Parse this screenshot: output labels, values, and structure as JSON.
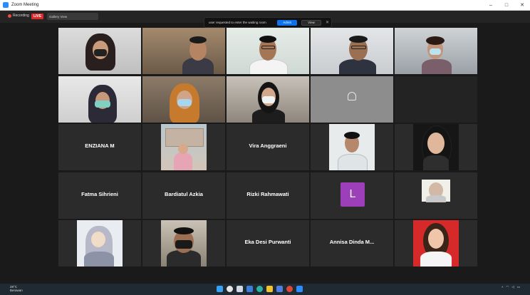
{
  "window": {
    "title": "Zoom Meeting",
    "controls": {
      "minimize": "–",
      "maximize": "□",
      "close": "✕"
    }
  },
  "meeting_bar": {
    "recording_label": "Recording",
    "live_label": "LIVE",
    "view_label": "Gallery View",
    "top_notice": "",
    "record_color": "#e84c3d"
  },
  "notification": {
    "text": "user requested to enter the waiting room",
    "admit_label": "Admit",
    "view_label": "View",
    "close_icon": "close-icon"
  },
  "tiles": [
    {
      "name": "",
      "kind": "video",
      "scene": "hijab-mask-dark"
    },
    {
      "name": "",
      "kind": "video",
      "scene": "man-1"
    },
    {
      "name": "",
      "kind": "video",
      "scene": "man-shirt-white"
    },
    {
      "name": "",
      "kind": "video",
      "scene": "man-glasses"
    },
    {
      "name": "",
      "kind": "video",
      "scene": "woman-mask"
    },
    {
      "name": "",
      "kind": "video",
      "scene": "hijab-mask-green"
    },
    {
      "name": "",
      "kind": "video",
      "scene": "hijab-orange-mask"
    },
    {
      "name": "",
      "kind": "video",
      "scene": "woman-mask-hair"
    },
    {
      "name": "",
      "kind": "video",
      "scene": "grey-placeholder"
    },
    {
      "name": "",
      "kind": "black"
    },
    {
      "name": "ENZIANA M",
      "kind": "text"
    },
    {
      "name": "",
      "kind": "video",
      "scene": "photo-building"
    },
    {
      "name": "Vira Anggraeni",
      "kind": "text"
    },
    {
      "name": "",
      "kind": "video",
      "scene": "man-portrait"
    },
    {
      "name": "",
      "kind": "video",
      "scene": "woman-portrait"
    },
    {
      "name": "Fatma Sihrieni",
      "kind": "text"
    },
    {
      "name": "Bardiatul Azkia",
      "kind": "text"
    },
    {
      "name": "Rizki Rahmawati",
      "kind": "text"
    },
    {
      "name": "",
      "kind": "letter",
      "letter": "L"
    },
    {
      "name": "",
      "kind": "video",
      "scene": "small-person"
    },
    {
      "name": "",
      "kind": "video",
      "scene": "cartoon"
    },
    {
      "name": "",
      "kind": "video",
      "scene": "man-mask-black"
    },
    {
      "name": "Eka Desi Purwanti",
      "kind": "text"
    },
    {
      "name": "Annisa Dinda M...",
      "kind": "text"
    },
    {
      "name": "",
      "kind": "video",
      "scene": "woman-red"
    }
  ],
  "taskbar": {
    "weather_temp": "28°C",
    "weather_desc": "Berawan",
    "time": "",
    "date": ""
  }
}
